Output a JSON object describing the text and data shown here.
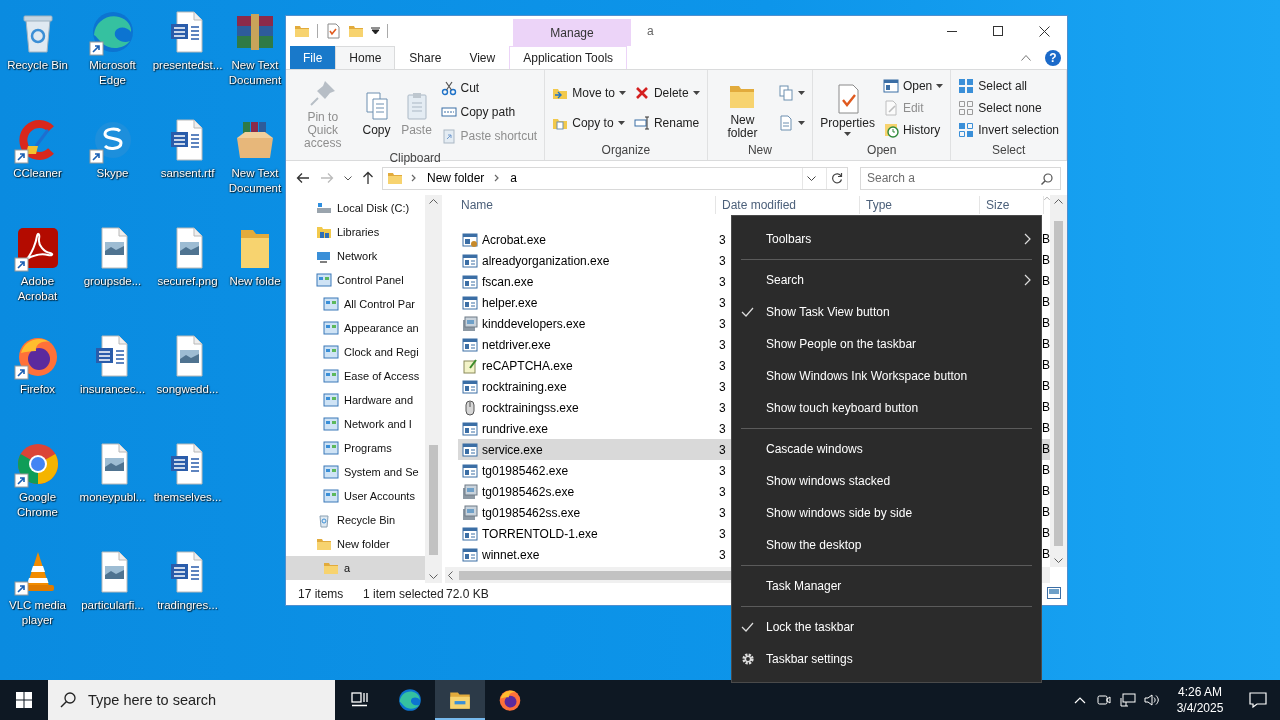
{
  "desktop": {
    "icons": [
      {
        "label": "Recycle Bin",
        "shortcut": false
      },
      {
        "label": "CCleaner",
        "shortcut": true
      },
      {
        "label": "Adobe Acrobat",
        "shortcut": true
      },
      {
        "label": "Firefox",
        "shortcut": true
      },
      {
        "label": "Google Chrome",
        "shortcut": true
      },
      {
        "label": "VLC media player",
        "shortcut": true
      },
      {
        "label": "Microsoft Edge",
        "shortcut": true
      },
      {
        "label": "Skype",
        "shortcut": true
      },
      {
        "label": "groupsde...",
        "shortcut": false
      },
      {
        "label": "insurancec...",
        "shortcut": false
      },
      {
        "label": "moneypubl...",
        "shortcut": false
      },
      {
        "label": "particularfi...",
        "shortcut": false
      },
      {
        "label": "presentedst...",
        "shortcut": false
      },
      {
        "label": "sansent.rtf",
        "shortcut": false
      },
      {
        "label": "securef.png",
        "shortcut": false
      },
      {
        "label": "songwedd...",
        "shortcut": false
      },
      {
        "label": "themselves...",
        "shortcut": false
      },
      {
        "label": "tradingres...",
        "shortcut": false
      },
      {
        "label": "New Text Document",
        "shortcut": false
      },
      {
        "label": "New Text Document",
        "shortcut": false
      },
      {
        "label": "New folde",
        "shortcut": false
      }
    ]
  },
  "explorer": {
    "contextual_group": "Manage",
    "title": "a",
    "help": "?",
    "tabs": [
      {
        "label": "File",
        "kind": "file",
        "selected": false
      },
      {
        "label": "Home",
        "kind": "tab",
        "selected": true
      },
      {
        "label": "Share",
        "kind": "tab",
        "selected": false
      },
      {
        "label": "View",
        "kind": "tab",
        "selected": false
      },
      {
        "label": "Application Tools",
        "kind": "contextual",
        "selected": false
      }
    ],
    "ribbon": {
      "groups": [
        {
          "label": "Clipboard",
          "columns": [
            [
              {
                "label": "Pin to Quick access",
                "kind": "large",
                "disabled": true,
                "dropdown": false
              }
            ],
            [
              {
                "label": "Copy",
                "kind": "large",
                "disabled": false,
                "dropdown": false
              }
            ],
            [
              {
                "label": "Paste",
                "kind": "large",
                "disabled": true,
                "dropdown": false
              }
            ],
            [
              {
                "label": "Cut",
                "kind": "small",
                "disabled": false,
                "dropdown": false
              },
              {
                "label": "Copy path",
                "kind": "small",
                "disabled": false,
                "dropdown": false
              },
              {
                "label": "Paste shortcut",
                "kind": "small",
                "disabled": true,
                "dropdown": false
              }
            ]
          ]
        },
        {
          "label": "Organize",
          "columns": [
            [
              {
                "label": "Move to",
                "kind": "small",
                "disabled": false,
                "dropdown": true
              },
              {
                "label": "Copy to",
                "kind": "small",
                "disabled": false,
                "dropdown": true
              }
            ],
            [
              {
                "label": "Delete",
                "kind": "small",
                "disabled": false,
                "dropdown": true
              },
              {
                "label": "Rename",
                "kind": "small",
                "disabled": false,
                "dropdown": false
              }
            ]
          ]
        },
        {
          "label": "New",
          "columns": [
            [
              {
                "label": "New folder",
                "kind": "large",
                "disabled": false,
                "dropdown": false
              }
            ],
            [
              {
                "kind": "icon",
                "disabled": false,
                "dropdown": true
              },
              {
                "kind": "icon",
                "disabled": false,
                "dropdown": true
              }
            ]
          ]
        },
        {
          "label": "Open",
          "columns": [
            [
              {
                "label": "Properties",
                "kind": "large",
                "disabled": false,
                "dropdown": true
              }
            ],
            [
              {
                "label": "Open",
                "kind": "small",
                "disabled": false,
                "dropdown": true
              },
              {
                "label": "Edit",
                "kind": "small",
                "disabled": true,
                "dropdown": false
              },
              {
                "label": "History",
                "kind": "small",
                "disabled": false,
                "dropdown": false
              }
            ]
          ]
        },
        {
          "label": "Select",
          "columns": [
            [
              {
                "label": "Select all",
                "kind": "small",
                "disabled": false,
                "dropdown": false
              },
              {
                "label": "Select none",
                "kind": "small",
                "disabled": false,
                "dropdown": false
              },
              {
                "label": "Invert selection",
                "kind": "small",
                "disabled": false,
                "dropdown": false
              }
            ]
          ]
        }
      ]
    },
    "address": {
      "path": [
        "New folder",
        "a"
      ]
    },
    "search": {
      "placeholder": "Search a"
    },
    "nav": {
      "items": [
        {
          "label": "Local Disk (C:)",
          "selected": false
        },
        {
          "label": "Libraries",
          "selected": false
        },
        {
          "label": "Network",
          "selected": false
        },
        {
          "label": "Control Panel",
          "selected": false,
          "children": [
            {
              "label": "All Control Par",
              "selected": false
            },
            {
              "label": "Appearance an",
              "selected": false
            },
            {
              "label": "Clock and Regi",
              "selected": false
            },
            {
              "label": "Ease of Access",
              "selected": false
            },
            {
              "label": "Hardware and",
              "selected": false
            },
            {
              "label": "Network and I",
              "selected": false
            },
            {
              "label": "Programs",
              "selected": false
            },
            {
              "label": "System and Se",
              "selected": false
            },
            {
              "label": "User Accounts",
              "selected": false
            }
          ]
        },
        {
          "label": "Recycle Bin",
          "selected": false
        },
        {
          "label": "New folder",
          "selected": false,
          "children": [
            {
              "label": "a",
              "selected": true
            }
          ]
        }
      ]
    },
    "file_list": {
      "columns": [
        "Name",
        "Date modified",
        "Type",
        "Size"
      ],
      "rows": [
        {
          "name": "Acrobat.exe",
          "date": "3",
          "size": "B",
          "selected": false
        },
        {
          "name": "alreadyorganization.exe",
          "date": "3",
          "size": "B",
          "selected": false
        },
        {
          "name": "fscan.exe",
          "date": "3",
          "size": "B",
          "selected": false
        },
        {
          "name": "helper.exe",
          "date": "3",
          "size": "B",
          "selected": false
        },
        {
          "name": "kinddevelopers.exe",
          "date": "3",
          "size": "B",
          "selected": false
        },
        {
          "name": "netdriver.exe",
          "date": "3",
          "size": "B",
          "selected": false
        },
        {
          "name": "reCAPTCHA.exe",
          "date": "3",
          "size": "B",
          "selected": false
        },
        {
          "name": "rocktraining.exe",
          "date": "3",
          "size": "B",
          "selected": false
        },
        {
          "name": "rocktrainingss.exe",
          "date": "3",
          "size": "B",
          "selected": false
        },
        {
          "name": "rundrive.exe",
          "date": "3",
          "size": "B",
          "selected": false
        },
        {
          "name": "service.exe",
          "date": "3",
          "size": "B",
          "selected": true
        },
        {
          "name": "tg01985462.exe",
          "date": "3",
          "size": "B",
          "selected": false
        },
        {
          "name": "tg01985462s.exe",
          "date": "3",
          "size": "B",
          "selected": false
        },
        {
          "name": "tg01985462ss.exe",
          "date": "3",
          "size": "B",
          "selected": false
        },
        {
          "name": "TORRENTOLD-1.exe",
          "date": "3",
          "size": "B",
          "selected": false
        },
        {
          "name": "winnet.exe",
          "date": "3",
          "size": "B",
          "selected": false
        }
      ]
    },
    "status": {
      "count": "17 items",
      "selection": "1 item selected",
      "size": "72.0 KB"
    }
  },
  "context_menu": {
    "groups": [
      [
        {
          "label": "Toolbars",
          "kind": "submenu"
        }
      ],
      [
        {
          "label": "Search",
          "kind": "submenu"
        },
        {
          "label": "Show Task View button",
          "kind": "toggle",
          "checked": true
        },
        {
          "label": "Show People on the taskbar",
          "kind": "toggle",
          "checked": false
        },
        {
          "label": "Show Windows Ink Workspace button",
          "kind": "toggle",
          "checked": false
        },
        {
          "label": "Show touch keyboard button",
          "kind": "toggle",
          "checked": false
        }
      ],
      [
        {
          "label": "Cascade windows",
          "kind": "command"
        },
        {
          "label": "Show windows stacked",
          "kind": "command"
        },
        {
          "label": "Show windows side by side",
          "kind": "command"
        },
        {
          "label": "Show the desktop",
          "kind": "command"
        }
      ],
      [
        {
          "label": "Task Manager",
          "kind": "command"
        }
      ],
      [
        {
          "label": "Lock the taskbar",
          "kind": "toggle",
          "checked": true
        },
        {
          "label": "Taskbar settings",
          "kind": "settings"
        }
      ]
    ]
  },
  "taskbar": {
    "search_placeholder": "Type here to search",
    "apps": [
      {
        "selected": false
      },
      {
        "selected": true
      },
      {
        "selected": false
      }
    ],
    "time": "4:26 AM",
    "date": "3/4/2025"
  }
}
